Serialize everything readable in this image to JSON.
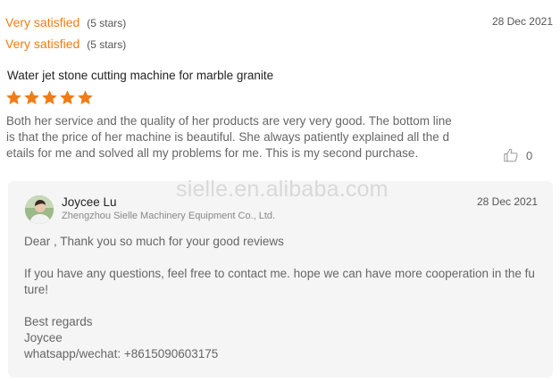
{
  "ratings": [
    {
      "label": "Very satisfied",
      "count_text": "(5 stars)"
    },
    {
      "label": "Very satisfied",
      "count_text": "(5 stars)"
    }
  ],
  "review": {
    "date": "28 Dec 2021",
    "product_title": "Water jet stone cutting machine for marble granite",
    "star_rating": 5,
    "star_color": "#f07c15",
    "text": "Both her service and the quality of her products are very very good. The bottom line is that the price of her machine is beautiful. She always patiently explained all the details for me and solved all my problems for me. This is my second purchase.",
    "like_icon": "thumbs-up-icon",
    "like_count": "0"
  },
  "watermark": "sielle.en.alibaba.com",
  "reply": {
    "avatar_icon": "avatar-photo",
    "name": "Joycee Lu",
    "company": "Zhengzhou Sielle Machinery Equipment Co., Ltd.",
    "date": "28 Dec 2021",
    "greeting": "Dear , Thank you so much for your good reviews",
    "body": "If you have any questions, feel free to contact me. hope we can have more cooperation in the future!",
    "sign_off": "Best regards",
    "signature": "Joycee",
    "contact": "whatsapp/wechat: +8615090603175"
  },
  "colors": {
    "accent": "#f07c15",
    "reply_background": "#f5f5f5",
    "watermark": "#d9d9d9"
  }
}
